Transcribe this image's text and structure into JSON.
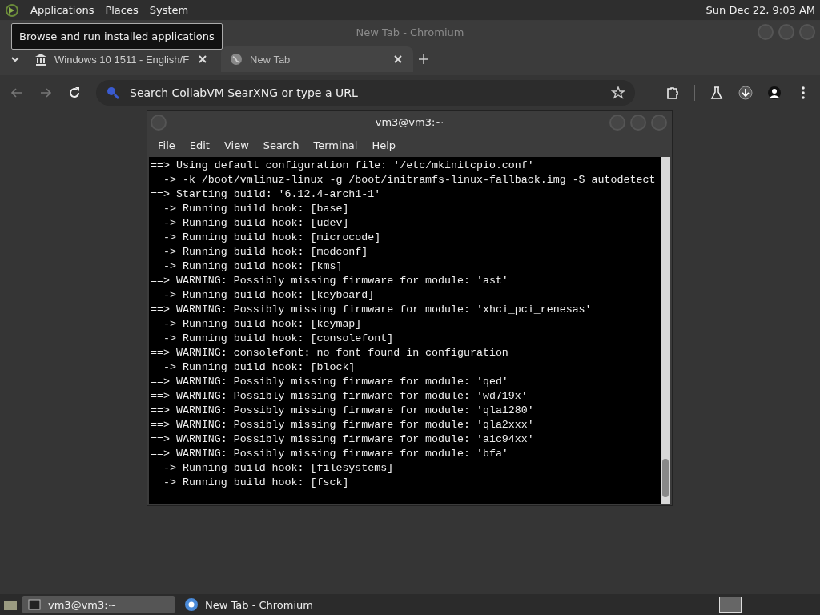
{
  "top_panel": {
    "menus": [
      "Applications",
      "Places",
      "System"
    ],
    "clock": "Sun Dec 22, 9:03 AM"
  },
  "tooltip": "Browse and run installed applications",
  "browser": {
    "title": "New Tab - Chromium",
    "tabs": [
      {
        "label": "Windows 10 1511 - English/F",
        "selected": false
      },
      {
        "label": "New Tab",
        "selected": true
      }
    ],
    "address_placeholder": "Search CollabVM SearXNG or type a URL"
  },
  "terminal": {
    "title": "vm3@vm3:~",
    "menus": [
      "File",
      "Edit",
      "View",
      "Search",
      "Terminal",
      "Help"
    ],
    "lines": [
      "==> Using default configuration file: '/etc/mkinitcpio.conf'",
      "  -> -k /boot/vmlinuz-linux -g /boot/initramfs-linux-fallback.img -S autodetect",
      "==> Starting build: '6.12.4-arch1-1'",
      "  -> Running build hook: [base]",
      "  -> Running build hook: [udev]",
      "  -> Running build hook: [microcode]",
      "  -> Running build hook: [modconf]",
      "  -> Running build hook: [kms]",
      "==> WARNING: Possibly missing firmware for module: 'ast'",
      "  -> Running build hook: [keyboard]",
      "==> WARNING: Possibly missing firmware for module: 'xhci_pci_renesas'",
      "  -> Running build hook: [keymap]",
      "  -> Running build hook: [consolefont]",
      "==> WARNING: consolefont: no font found in configuration",
      "  -> Running build hook: [block]",
      "==> WARNING: Possibly missing firmware for module: 'qed'",
      "==> WARNING: Possibly missing firmware for module: 'wd719x'",
      "==> WARNING: Possibly missing firmware for module: 'qla1280'",
      "==> WARNING: Possibly missing firmware for module: 'qla2xxx'",
      "==> WARNING: Possibly missing firmware for module: 'aic94xx'",
      "==> WARNING: Possibly missing firmware for module: 'bfa'",
      "  -> Running build hook: [filesystems]",
      "  -> Running build hook: [fsck]"
    ]
  },
  "taskbar": {
    "items": [
      {
        "label": "vm3@vm3:~",
        "selected": true
      },
      {
        "label": "New Tab - Chromium",
        "selected": false
      }
    ]
  }
}
